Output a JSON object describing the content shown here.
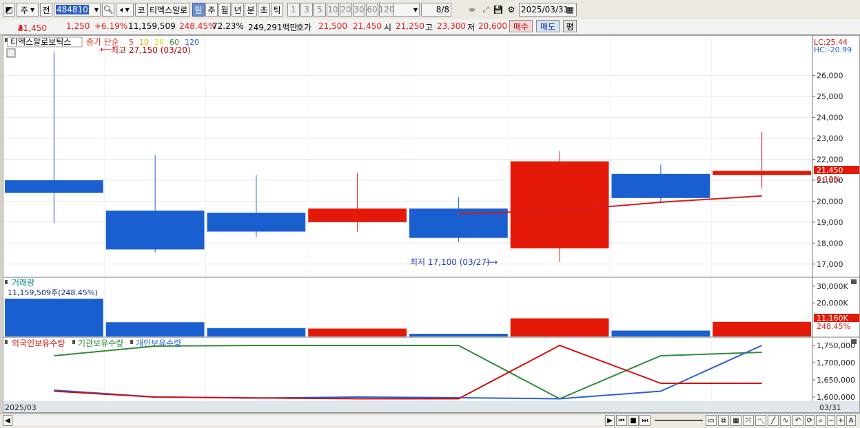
{
  "toolbar": {
    "period_toggle": "주",
    "prev_label": "전",
    "code": "484810",
    "stock_name": "티엑스알로",
    "ko_label": "코",
    "periods": [
      {
        "label": "일",
        "selected": true
      },
      {
        "label": "주",
        "selected": false
      },
      {
        "label": "월",
        "selected": false
      },
      {
        "label": "년",
        "selected": false
      },
      {
        "label": "분",
        "selected": false
      },
      {
        "label": "초",
        "selected": false
      },
      {
        "label": "틱",
        "selected": false
      }
    ],
    "intervals": [
      "1",
      "3",
      "5",
      "10",
      "20",
      "30",
      "60",
      "120"
    ],
    "count": "8/8",
    "date": "2025/03/31"
  },
  "infobar": {
    "price": "21,450",
    "change": "1,250",
    "change_pct": "+6.19%",
    "volume": "11,159,509",
    "volume_ratio": "248.45%",
    "turnover": "72.23%",
    "amount": "249,291백만",
    "hoga_label": "호가",
    "ask": "21,500",
    "bid": "21,450",
    "open_label": "시",
    "open": "21,250",
    "high_label": "고",
    "high": "23,300",
    "low_label": "저",
    "low": "20,600",
    "buy_label": "매수",
    "sell_label": "매도",
    "avg_label": "평"
  },
  "price_panel": {
    "stock_title": "티엑스알로보틱스",
    "ma_label": "종가 단순",
    "ma_periods": [
      "5",
      "10",
      "20",
      "60",
      "120"
    ],
    "ma_colors": [
      "#e03a1a",
      "#e6a800",
      "#d8d800",
      "#2e8b3c",
      "#2060d0"
    ],
    "lc": "LC:25.44",
    "hc": "HC:-20.99",
    "max_note": "최고 27,150 (03/20)",
    "min_note": "최저 17,100 (03/27)",
    "price_tag": "21,450",
    "pct_tag": "6.19%",
    "yticks": [
      "26,000",
      "25,000",
      "24,000",
      "23,000",
      "22,000",
      "21,000",
      "20,000",
      "19,000",
      "18,000",
      "17,000"
    ]
  },
  "volume_panel": {
    "title": "거래량",
    "info": "11,159,509주(248.45%)",
    "yticks": [
      "30,000K",
      "20,000K"
    ],
    "tag": "11,160K",
    "tag_pct": "248.45%"
  },
  "holding_panel": {
    "legend": [
      {
        "label": "외국인보유수량",
        "color": "#d01010"
      },
      {
        "label": "기관보유수량",
        "color": "#2e8b3c"
      },
      {
        "label": "개인보유수량",
        "color": "#2a5fd8"
      }
    ],
    "yticks": [
      "1,750,000",
      "1,700,000",
      "1,650,000",
      "1,600,000"
    ]
  },
  "xaxis": {
    "start": "2025/03",
    "end": "03/31"
  },
  "chart_data": {
    "type": "candlestick",
    "candles": [
      {
        "open": 21000,
        "close": 20400,
        "high": 27150,
        "low": 18950,
        "color": "#1a5fd0"
      },
      {
        "open": 19550,
        "close": 17700,
        "high": 22200,
        "low": 17550,
        "color": "#1a5fd0"
      },
      {
        "open": 19450,
        "close": 18550,
        "high": 21250,
        "low": 18300,
        "color": "#1a5fd0"
      },
      {
        "open": 19000,
        "close": 19650,
        "high": 21350,
        "low": 18550,
        "color": "#e31a0a"
      },
      {
        "open": 19650,
        "close": 18250,
        "high": 20200,
        "low": 18050,
        "color": "#1a5fd0"
      },
      {
        "open": 17750,
        "close": 21900,
        "high": 22400,
        "low": 17100,
        "color": "#e31a0a"
      },
      {
        "open": 21300,
        "close": 20150,
        "high": 21750,
        "low": 19900,
        "color": "#1a5fd0"
      },
      {
        "open": 21250,
        "close": 21450,
        "high": 23300,
        "low": 20600,
        "color": "#e31a0a"
      }
    ],
    "ma5": [
      null,
      null,
      null,
      null,
      19400,
      19550,
      19950,
      20250
    ],
    "volume_k": [
      22500,
      8500,
      5000,
      4700,
      1600,
      10800,
      3500,
      8700
    ],
    "volume_colors": [
      "#1a5fd0",
      "#1a5fd0",
      "#1a5fd0",
      "#e31a0a",
      "#1a5fd0",
      "#e31a0a",
      "#1a5fd0",
      "#e31a0a"
    ],
    "foreign": [
      1617000,
      1600000,
      null,
      1595000,
      1595000,
      1750000,
      1640000,
      1640000
    ],
    "institution": [
      1720000,
      1748000,
      1750000,
      1750000,
      1750000,
      1595000,
      1720000,
      1730000
    ],
    "individual": [
      1620000,
      1600000,
      1597000,
      1600000,
      1598000,
      1595000,
      1617000,
      1750000
    ],
    "price_ylim": [
      16500,
      27300
    ],
    "volume_ylim": [
      0,
      34000
    ],
    "holding_ylim": [
      1590000,
      1762000
    ]
  }
}
